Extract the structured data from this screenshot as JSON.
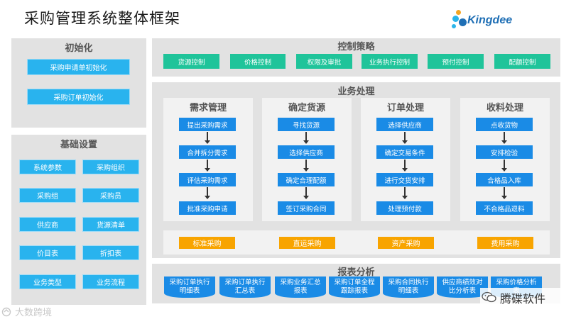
{
  "title": "采购管理系统整体框架",
  "logo": {
    "text": "Kingdee",
    "colors": [
      "#f5a623",
      "#2bb5ea",
      "#1f6fb5"
    ]
  },
  "init": {
    "title": "初始化",
    "items": [
      "采购申请单初始化",
      "采购订单初始化"
    ]
  },
  "basic": {
    "title": "基础设置",
    "items": [
      "系统参数",
      "采购组织",
      "采购组",
      "采购员",
      "供应商",
      "货源清单",
      "价目表",
      "折扣表",
      "业务类型",
      "业务流程"
    ]
  },
  "control": {
    "title": "控制策略",
    "items": [
      "货源控制",
      "价格控制",
      "权限及审批",
      "业务执行控制",
      "预付控制",
      "配额控制"
    ]
  },
  "business": {
    "title": "业务处理",
    "columns": [
      {
        "title": "需求管理",
        "steps": [
          "提出采购需求",
          "合并拆分需求",
          "评估采购需求",
          "批准采购申请"
        ]
      },
      {
        "title": "确定货源",
        "steps": [
          "寻找货源",
          "选择供应商",
          "确定合理配额",
          "签订采购合同"
        ]
      },
      {
        "title": "订单处理",
        "steps": [
          "选择供应商",
          "确定交易条件",
          "进行交货安排",
          "处理预付款"
        ]
      },
      {
        "title": "收料处理",
        "steps": [
          "点收货物",
          "安排检验",
          "合格品入库",
          "不合格品退料"
        ]
      }
    ],
    "types": [
      "标准采购",
      "直运采购",
      "资产采购",
      "费用采购"
    ]
  },
  "reports": {
    "title": "报表分析",
    "items": [
      [
        "采购订单执行",
        "明细表"
      ],
      [
        "采购订单执行",
        "汇总表"
      ],
      [
        "采购业务汇总",
        "报表"
      ],
      [
        "采购订单全程",
        "跟踪报表"
      ],
      [
        "采购合同执行",
        "明细表"
      ],
      [
        "供应商绩效对",
        "比分析表"
      ],
      [
        "采购价格分析",
        "表"
      ]
    ]
  },
  "wechat_label": "腾碟软件",
  "watermark": "大数跨境",
  "colors": {
    "blue_btn": "#29b3ee",
    "green": "#1fc49a",
    "orange": "#f8a400",
    "step_blue": "#1a8be6",
    "panel_gray": "#e2e2e2"
  }
}
